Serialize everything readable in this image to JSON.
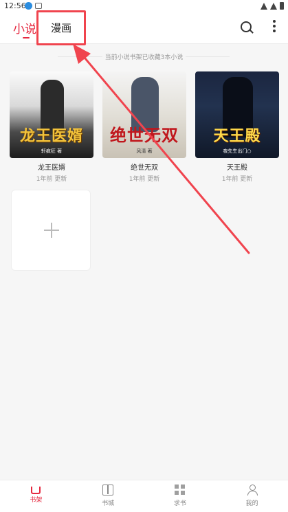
{
  "status_bar": {
    "time": "12:56"
  },
  "header": {
    "tabs": [
      {
        "label": "小说",
        "active": true
      },
      {
        "label": "漫画",
        "active": false
      }
    ],
    "accent_color": "#e5283f"
  },
  "shelf": {
    "summary": "当前小说书架已收藏3本小说",
    "books": [
      {
        "title": "龙王医婿",
        "meta": "1年前 更新",
        "cover_title": "龙王医婿",
        "cover_author": "轩疯狂 著"
      },
      {
        "title": "绝世无双",
        "meta": "1年前 更新",
        "cover_title": "绝世无双",
        "cover_author": "风清 著"
      },
      {
        "title": "天王殿",
        "meta": "1年前 更新",
        "cover_title": "天王殿",
        "cover_author": "夜先生出门○"
      }
    ]
  },
  "bottom_nav": [
    {
      "label": "书架",
      "icon": "home-icon",
      "active": true
    },
    {
      "label": "书城",
      "icon": "book-icon",
      "active": false
    },
    {
      "label": "求书",
      "icon": "grid-icon",
      "active": false
    },
    {
      "label": "我的",
      "icon": "user-icon",
      "active": false
    }
  ],
  "annotation": {
    "color": "#f0444e"
  }
}
